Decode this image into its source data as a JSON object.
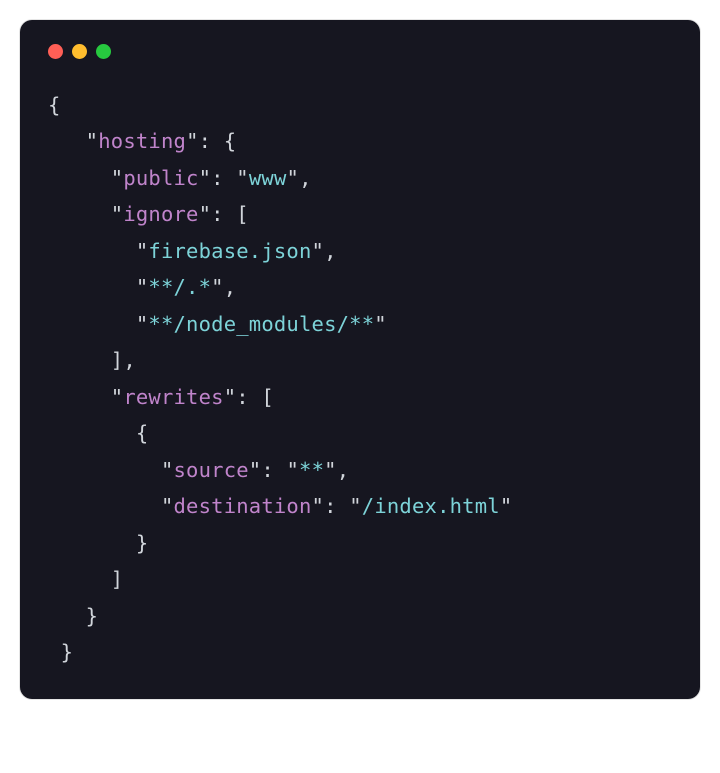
{
  "code": {
    "brace_open": "{",
    "brace_close": "}",
    "bracket_open": "[",
    "bracket_close": "]",
    "colon": ":",
    "comma": ",",
    "quote": "\"",
    "keys": {
      "hosting": "hosting",
      "public": "public",
      "ignore": "ignore",
      "rewrites": "rewrites",
      "source": "source",
      "destination": "destination"
    },
    "values": {
      "public": "www",
      "ignore0": "firebase.json",
      "ignore1": "**/.*",
      "ignore2": "**/node_modules/**",
      "source": "**",
      "destination": "/index.html"
    }
  }
}
